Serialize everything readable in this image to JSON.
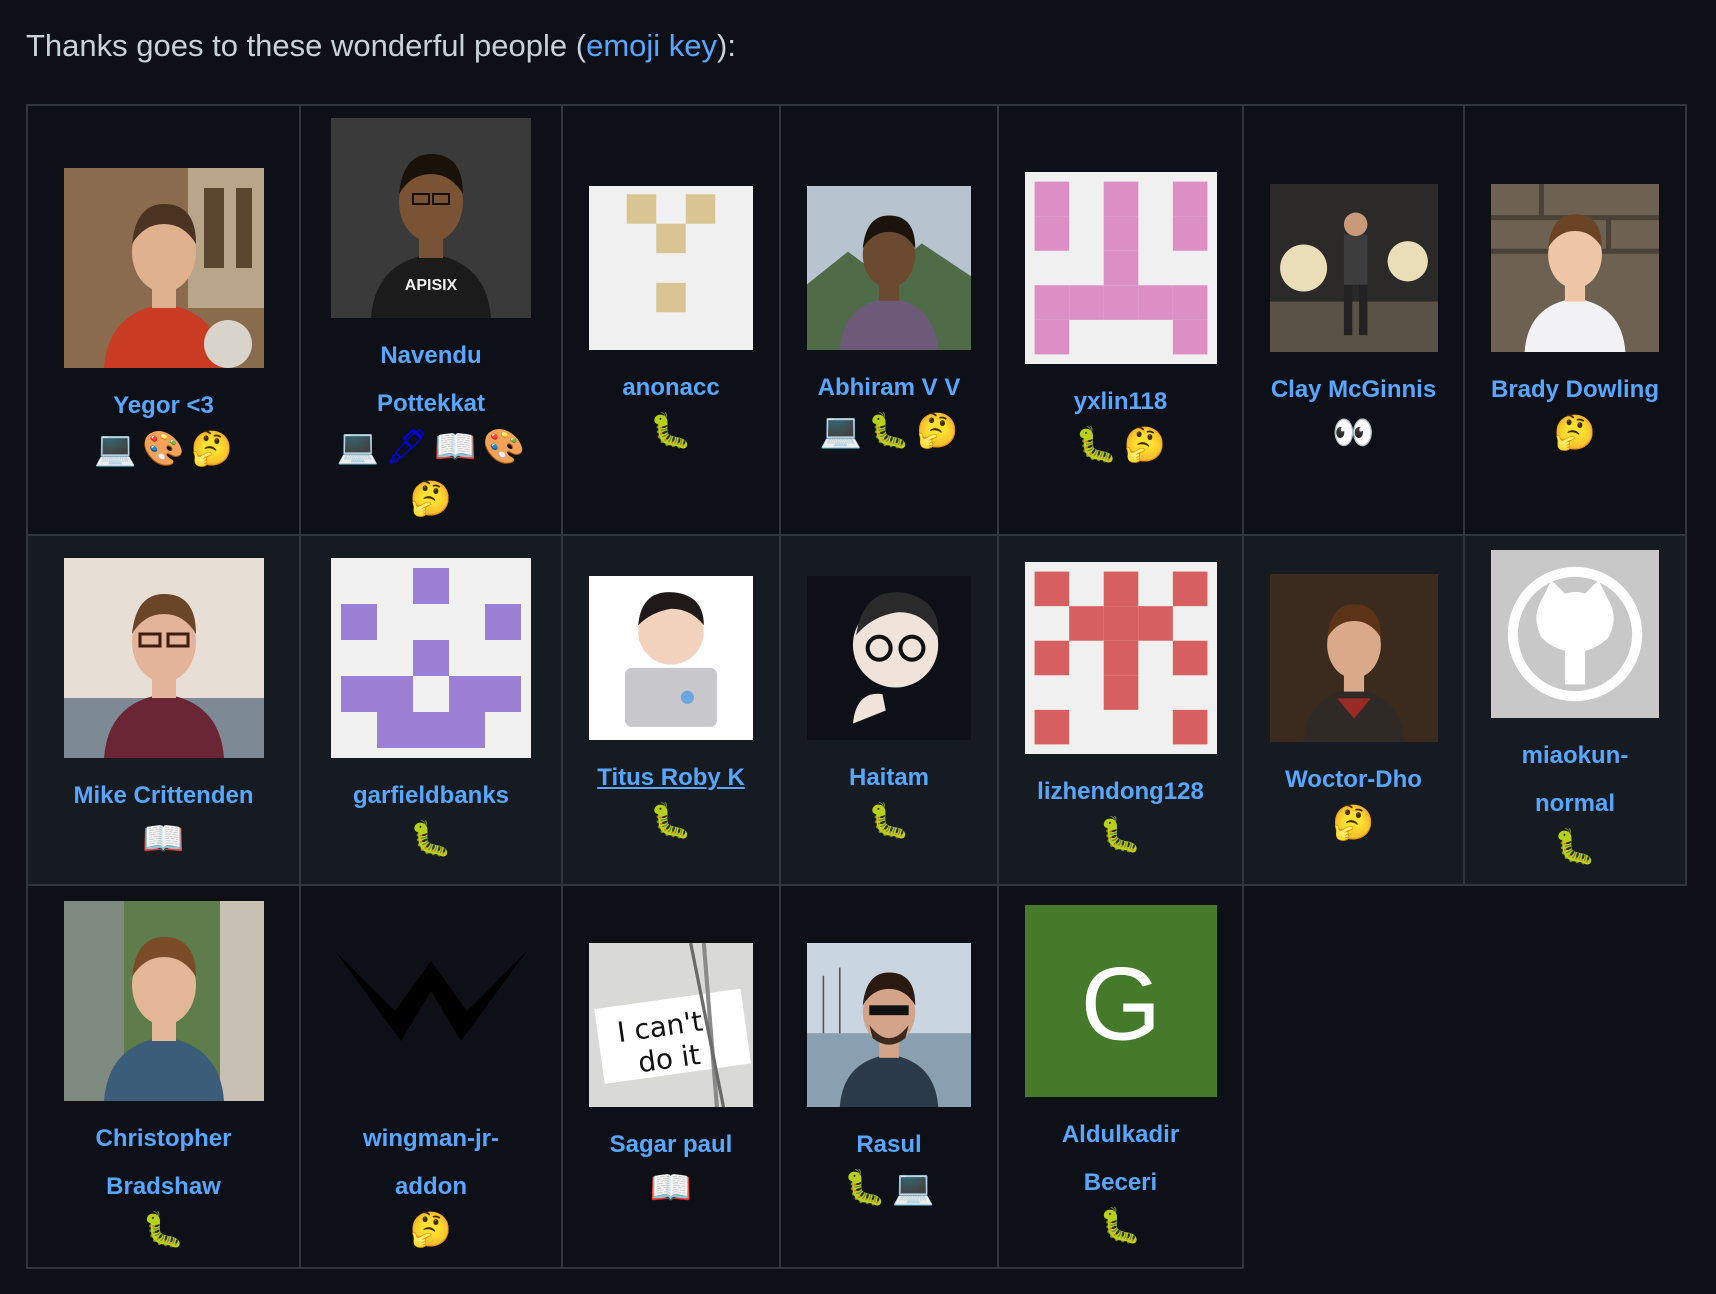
{
  "intro": {
    "prefix": "Thanks goes to these wonderful people (",
    "link": "emoji key",
    "suffix": "):"
  },
  "emoji": {
    "code": "💻",
    "design": "🎨",
    "ideas": "🤔",
    "content": "🖋",
    "doc": "📖",
    "bug": "🐛",
    "review": "👀"
  },
  "contributors": [
    {
      "name": "Yegor <3",
      "avatar": "photo-red-hoodie",
      "contributions": [
        "code",
        "design",
        "ideas"
      ]
    },
    {
      "name": "Navendu Pottekkat",
      "avatar": "photo-apisix-shirt",
      "contributions": [
        "code",
        "content",
        "doc",
        "design",
        "ideas"
      ]
    },
    {
      "name": "anonacc",
      "avatar": "identicon-tan",
      "contributions": [
        "bug"
      ]
    },
    {
      "name": "Abhiram V V",
      "avatar": "photo-mountains",
      "contributions": [
        "code",
        "bug",
        "ideas"
      ]
    },
    {
      "name": "yxlin118",
      "avatar": "identicon-pink",
      "contributions": [
        "bug",
        "ideas"
      ]
    },
    {
      "name": "Clay McGinnis",
      "avatar": "photo-stage-lights",
      "contributions": [
        "review"
      ]
    },
    {
      "name": "Brady Dowling",
      "avatar": "photo-stone-wall",
      "contributions": [
        "ideas"
      ]
    },
    {
      "name": "Mike Crittenden",
      "avatar": "photo-glasses-sunset",
      "contributions": [
        "doc"
      ]
    },
    {
      "name": "garfieldbanks",
      "avatar": "identicon-purple",
      "contributions": [
        "bug"
      ]
    },
    {
      "name": "Titus Roby K",
      "avatar": "memoji-laptop",
      "contributions": [
        "bug"
      ]
    },
    {
      "name": "Haitam",
      "avatar": "memoji-thinking",
      "contributions": [
        "bug"
      ]
    },
    {
      "name": "lizhendong128",
      "avatar": "identicon-red",
      "contributions": [
        "bug"
      ]
    },
    {
      "name": "Woctor-Dho",
      "avatar": "photo-doctor",
      "contributions": [
        "ideas"
      ]
    },
    {
      "name": "miaokun-normal",
      "avatar": "github-octocat",
      "contributions": [
        "bug"
      ]
    },
    {
      "name": "Christopher Bradshaw",
      "avatar": "photo-plants",
      "contributions": [
        "bug"
      ]
    },
    {
      "name": "wingman-jr-addon",
      "avatar": "w-logo",
      "contributions": [
        "ideas"
      ]
    },
    {
      "name": "Sagar paul",
      "avatar": "photo-i-cant-do-it",
      "contributions": [
        "doc"
      ]
    },
    {
      "name": "Rasul",
      "avatar": "photo-harbor",
      "contributions": [
        "bug",
        "code"
      ]
    },
    {
      "name": "Aldulkadir Beceri",
      "avatar": "letter-g",
      "contributions": [
        "bug"
      ]
    }
  ],
  "avatar_text": {
    "apisix": "APISIX",
    "cant1": "I can't",
    "cant2": "do it",
    "letter": "G"
  },
  "colors": {
    "background": "#0d1117",
    "alt_row": "#161b22",
    "border": "#30363d",
    "link": "#58a6ff",
    "text": "#c9d1d9",
    "identicon_tan": "#d9c593",
    "identicon_pink": "#dc8fc4",
    "identicon_purple": "#9a7fd2",
    "identicon_red": "#d6605f",
    "letter_g_bg": "#447a2a"
  }
}
